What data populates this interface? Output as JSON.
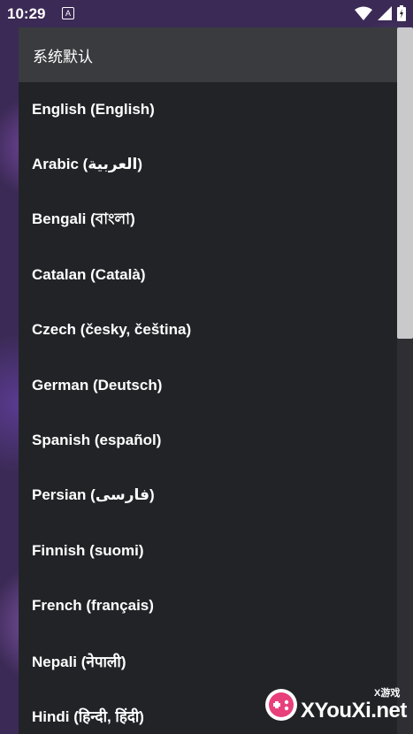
{
  "statusbar": {
    "time": "10:29",
    "a_badge": "A",
    "icons": [
      "wifi-icon",
      "signal-icon",
      "battery-icon"
    ]
  },
  "dialog": {
    "header": "系统默认",
    "items": [
      {
        "label": "English (English)"
      },
      {
        "label": "Arabic (العربية)"
      },
      {
        "label": "Bengali (বাংলা)"
      },
      {
        "label": "Catalan (Català)"
      },
      {
        "label": "Czech (česky, čeština)"
      },
      {
        "label": "German (Deutsch)"
      },
      {
        "label": "Spanish (español)"
      },
      {
        "label": "Persian (فارسی)"
      },
      {
        "label": "Finnish (suomi)"
      },
      {
        "label": "French (français)"
      },
      {
        "label": "Nepali (नेपाली)"
      },
      {
        "label": "Hindi (हिन्दी, हिंदी)"
      }
    ]
  },
  "scrollbar": {
    "thumb_fraction": 0.44
  },
  "watermark": {
    "text": "XYouXi.net",
    "sub": "X游戏"
  },
  "colors": {
    "dialog_bg": "#222327",
    "header_bg": "#3a3b3f",
    "text": "#ffffff"
  }
}
